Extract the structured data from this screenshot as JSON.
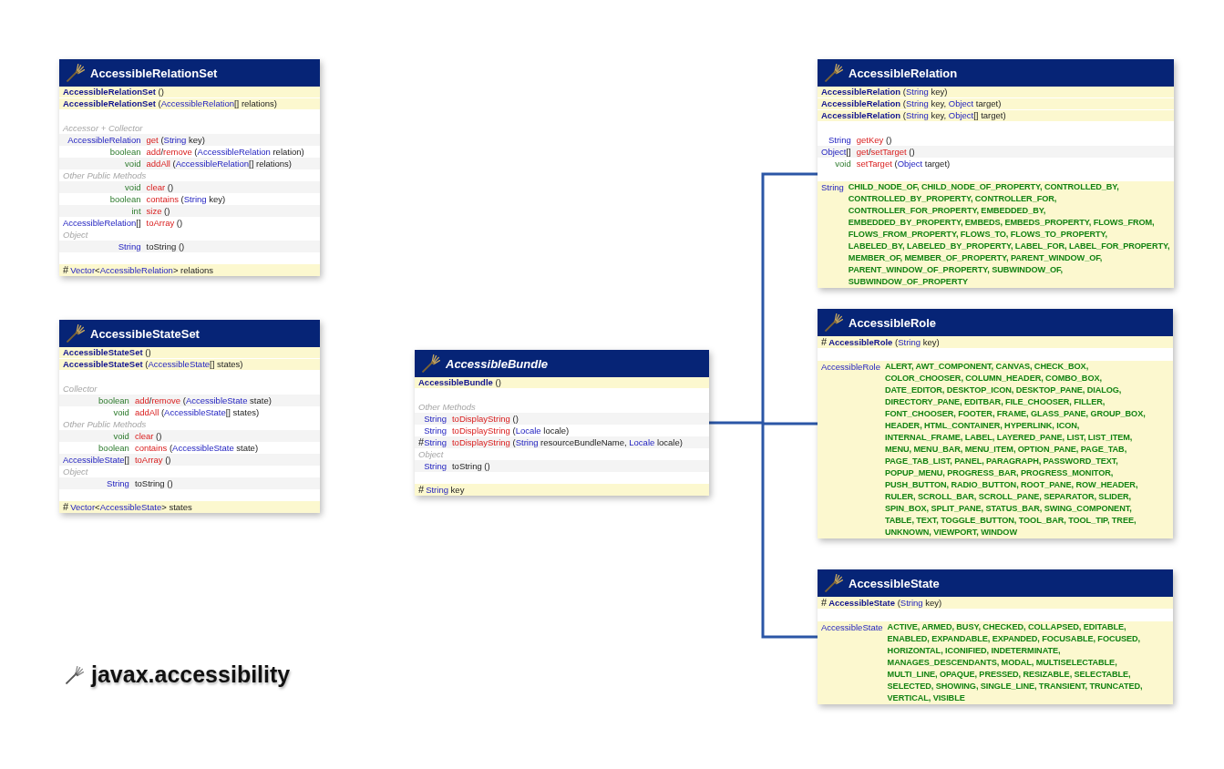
{
  "diagram": {
    "title": "javax.accessibility"
  },
  "classes": [
    {
      "name": "AccessibleRelationSet",
      "abstract": false,
      "constructors": [
        {
          "signature": [
            {
              "text": "AccessibleRelationSet",
              "kind": "ctor"
            },
            {
              "text": " ()",
              "kind": "plain"
            }
          ]
        },
        {
          "signature": [
            {
              "text": "AccessibleRelationSet",
              "kind": "ctor"
            },
            {
              "text": " (",
              "kind": "plain"
            },
            {
              "text": "AccessibleRelation",
              "kind": "class"
            },
            {
              "text": "[] relations)",
              "kind": "plain"
            }
          ]
        }
      ],
      "method_groups": [
        {
          "label": "Accessor + Collector",
          "methods": [
            {
              "type": [
                {
                  "text": "AccessibleRelation",
                  "kind": "class"
                }
              ],
              "signature": [
                {
                  "text": "get",
                  "kind": "method"
                },
                {
                  "text": " (",
                  "kind": "plain"
                },
                {
                  "text": "String",
                  "kind": "class"
                },
                {
                  "text": " key)",
                  "kind": "plain"
                }
              ]
            },
            {
              "type": [
                {
                  "text": "boolean",
                  "kind": "primitive"
                }
              ],
              "signature": [
                {
                  "text": "add",
                  "kind": "method"
                },
                {
                  "text": "/",
                  "kind": "plain"
                },
                {
                  "text": "remove",
                  "kind": "method"
                },
                {
                  "text": " (",
                  "kind": "plain"
                },
                {
                  "text": "AccessibleRelation",
                  "kind": "class"
                },
                {
                  "text": " relation)",
                  "kind": "plain"
                }
              ]
            },
            {
              "type": [
                {
                  "text": "void",
                  "kind": "primitive"
                }
              ],
              "signature": [
                {
                  "text": "addAll",
                  "kind": "method"
                },
                {
                  "text": " (",
                  "kind": "plain"
                },
                {
                  "text": "AccessibleRelation",
                  "kind": "class"
                },
                {
                  "text": "[] relations)",
                  "kind": "plain"
                }
              ]
            }
          ]
        },
        {
          "label": "Other Public Methods",
          "methods": [
            {
              "type": [
                {
                  "text": "void",
                  "kind": "primitive"
                }
              ],
              "signature": [
                {
                  "text": "clear",
                  "kind": "method"
                },
                {
                  "text": " ()",
                  "kind": "plain"
                }
              ]
            },
            {
              "type": [
                {
                  "text": "boolean",
                  "kind": "primitive"
                }
              ],
              "signature": [
                {
                  "text": "contains",
                  "kind": "method"
                },
                {
                  "text": " (",
                  "kind": "plain"
                },
                {
                  "text": "String",
                  "kind": "class"
                },
                {
                  "text": " key)",
                  "kind": "plain"
                }
              ]
            },
            {
              "type": [
                {
                  "text": "int",
                  "kind": "primitive"
                }
              ],
              "signature": [
                {
                  "text": "size",
                  "kind": "method"
                },
                {
                  "text": " ()",
                  "kind": "plain"
                }
              ]
            },
            {
              "type": [
                {
                  "text": "AccessibleRelation",
                  "kind": "class"
                },
                {
                  "text": "[]",
                  "kind": "plain"
                }
              ],
              "signature": [
                {
                  "text": "toArray",
                  "kind": "method"
                },
                {
                  "text": " ()",
                  "kind": "plain"
                }
              ]
            }
          ]
        },
        {
          "label": "Object",
          "methods": [
            {
              "type": [
                {
                  "text": "String",
                  "kind": "class"
                }
              ],
              "signature": [
                {
                  "text": "toString ()",
                  "kind": "plain"
                }
              ]
            }
          ]
        }
      ],
      "fields": [
        {
          "kind": "field",
          "modifier": "#",
          "declaration": [
            {
              "text": "Vector",
              "kind": "class"
            },
            {
              "text": "<",
              "kind": "plain"
            },
            {
              "text": "AccessibleRelation",
              "kind": "class"
            },
            {
              "text": "> relations",
              "kind": "plain"
            }
          ]
        }
      ]
    },
    {
      "name": "AccessibleStateSet",
      "abstract": false,
      "constructors": [
        {
          "signature": [
            {
              "text": "AccessibleStateSet",
              "kind": "ctor"
            },
            {
              "text": " ()",
              "kind": "plain"
            }
          ]
        },
        {
          "signature": [
            {
              "text": "AccessibleStateSet",
              "kind": "ctor"
            },
            {
              "text": " (",
              "kind": "plain"
            },
            {
              "text": "AccessibleState",
              "kind": "class"
            },
            {
              "text": "[] states)",
              "kind": "plain"
            }
          ]
        }
      ],
      "method_groups": [
        {
          "label": "Collector",
          "methods": [
            {
              "type": [
                {
                  "text": "boolean",
                  "kind": "primitive"
                }
              ],
              "signature": [
                {
                  "text": "add",
                  "kind": "method"
                },
                {
                  "text": "/",
                  "kind": "plain"
                },
                {
                  "text": "remove",
                  "kind": "method"
                },
                {
                  "text": " (",
                  "kind": "plain"
                },
                {
                  "text": "AccessibleState",
                  "kind": "class"
                },
                {
                  "text": " state)",
                  "kind": "plain"
                }
              ]
            },
            {
              "type": [
                {
                  "text": "void",
                  "kind": "primitive"
                }
              ],
              "signature": [
                {
                  "text": "addAll",
                  "kind": "method"
                },
                {
                  "text": " (",
                  "kind": "plain"
                },
                {
                  "text": "AccessibleState",
                  "kind": "class"
                },
                {
                  "text": "[] states)",
                  "kind": "plain"
                }
              ]
            }
          ]
        },
        {
          "label": "Other Public Methods",
          "methods": [
            {
              "type": [
                {
                  "text": "void",
                  "kind": "primitive"
                }
              ],
              "signature": [
                {
                  "text": "clear",
                  "kind": "method"
                },
                {
                  "text": " ()",
                  "kind": "plain"
                }
              ]
            },
            {
              "type": [
                {
                  "text": "boolean",
                  "kind": "primitive"
                }
              ],
              "signature": [
                {
                  "text": "contains",
                  "kind": "method"
                },
                {
                  "text": " (",
                  "kind": "plain"
                },
                {
                  "text": "AccessibleState",
                  "kind": "class"
                },
                {
                  "text": " state)",
                  "kind": "plain"
                }
              ]
            },
            {
              "type": [
                {
                  "text": "AccessibleState",
                  "kind": "class"
                },
                {
                  "text": "[]",
                  "kind": "plain"
                }
              ],
              "signature": [
                {
                  "text": "toArray",
                  "kind": "method"
                },
                {
                  "text": " ()",
                  "kind": "plain"
                }
              ]
            }
          ]
        },
        {
          "label": "Object",
          "methods": [
            {
              "type": [
                {
                  "text": "String",
                  "kind": "class"
                }
              ],
              "signature": [
                {
                  "text": "toString ()",
                  "kind": "plain"
                }
              ]
            }
          ]
        }
      ],
      "fields": [
        {
          "kind": "field",
          "modifier": "#",
          "declaration": [
            {
              "text": "Vector",
              "kind": "class"
            },
            {
              "text": "<",
              "kind": "plain"
            },
            {
              "text": "AccessibleState",
              "kind": "class"
            },
            {
              "text": "> states",
              "kind": "plain"
            }
          ]
        }
      ]
    },
    {
      "name": "AccessibleBundle",
      "abstract": true,
      "constructors": [
        {
          "signature": [
            {
              "text": "AccessibleBundle",
              "kind": "ctor"
            },
            {
              "text": " ()",
              "kind": "plain"
            }
          ]
        }
      ],
      "method_groups": [
        {
          "label": "Other Methods",
          "methods": [
            {
              "type": [
                {
                  "text": "String",
                  "kind": "class"
                }
              ],
              "signature": [
                {
                  "text": "toDisplayString",
                  "kind": "method"
                },
                {
                  "text": " ()",
                  "kind": "plain"
                }
              ]
            },
            {
              "type": [
                {
                  "text": "String",
                  "kind": "class"
                }
              ],
              "signature": [
                {
                  "text": "toDisplayString",
                  "kind": "method"
                },
                {
                  "text": " (",
                  "kind": "plain"
                },
                {
                  "text": "Locale",
                  "kind": "class"
                },
                {
                  "text": " locale)",
                  "kind": "plain"
                }
              ]
            },
            {
              "modifier": "#",
              "type": [
                {
                  "text": "String",
                  "kind": "class"
                }
              ],
              "signature": [
                {
                  "text": "toDisplayString",
                  "kind": "method"
                },
                {
                  "text": " (",
                  "kind": "plain"
                },
                {
                  "text": "String",
                  "kind": "class"
                },
                {
                  "text": " resourceBundleName, ",
                  "kind": "plain"
                },
                {
                  "text": "Locale",
                  "kind": "class"
                },
                {
                  "text": " locale)",
                  "kind": "plain"
                }
              ]
            }
          ]
        },
        {
          "label": "Object",
          "methods": [
            {
              "type": [
                {
                  "text": "String",
                  "kind": "class"
                }
              ],
              "signature": [
                {
                  "text": "toString ()",
                  "kind": "plain"
                }
              ]
            }
          ]
        }
      ],
      "fields": [
        {
          "kind": "field",
          "modifier": "#",
          "declaration": [
            {
              "text": "String",
              "kind": "class"
            },
            {
              "text": " key",
              "kind": "plain"
            }
          ]
        }
      ]
    },
    {
      "name": "AccessibleRelation",
      "abstract": false,
      "constructors": [
        {
          "signature": [
            {
              "text": "AccessibleRelation",
              "kind": "ctor"
            },
            {
              "text": " (",
              "kind": "plain"
            },
            {
              "text": "String",
              "kind": "class"
            },
            {
              "text": " key)",
              "kind": "plain"
            }
          ]
        },
        {
          "signature": [
            {
              "text": "AccessibleRelation",
              "kind": "ctor"
            },
            {
              "text": " (",
              "kind": "plain"
            },
            {
              "text": "String",
              "kind": "class"
            },
            {
              "text": " key, ",
              "kind": "plain"
            },
            {
              "text": "Object",
              "kind": "class"
            },
            {
              "text": " target)",
              "kind": "plain"
            }
          ]
        },
        {
          "signature": [
            {
              "text": "AccessibleRelation",
              "kind": "ctor"
            },
            {
              "text": " (",
              "kind": "plain"
            },
            {
              "text": "String",
              "kind": "class"
            },
            {
              "text": " key, ",
              "kind": "plain"
            },
            {
              "text": "Object",
              "kind": "class"
            },
            {
              "text": "[] target)",
              "kind": "plain"
            }
          ]
        }
      ],
      "method_groups": [
        {
          "methods": [
            {
              "type": [
                {
                  "text": "String",
                  "kind": "class"
                }
              ],
              "signature": [
                {
                  "text": "getKey",
                  "kind": "method"
                },
                {
                  "text": " ()",
                  "kind": "plain"
                }
              ]
            },
            {
              "type": [
                {
                  "text": "Object",
                  "kind": "class"
                },
                {
                  "text": "[]",
                  "kind": "plain"
                }
              ],
              "signature": [
                {
                  "text": "get",
                  "kind": "method"
                },
                {
                  "text": "/",
                  "kind": "plain"
                },
                {
                  "text": "setTarget",
                  "kind": "method"
                },
                {
                  "text": " ()",
                  "kind": "plain"
                }
              ]
            },
            {
              "type": [
                {
                  "text": "void",
                  "kind": "primitive"
                }
              ],
              "signature": [
                {
                  "text": "setTarget",
                  "kind": "method"
                },
                {
                  "text": " (",
                  "kind": "plain"
                },
                {
                  "text": "Object",
                  "kind": "class"
                },
                {
                  "text": " target)",
                  "kind": "plain"
                }
              ]
            }
          ]
        }
      ],
      "fields": [
        {
          "kind": "constants",
          "type": [
            {
              "text": "String",
              "kind": "class"
            }
          ],
          "lines": [
            "CHILD_NODE_OF, CHILD_NODE_OF_PROPERTY, CONTROLLED_BY,",
            "CONTROLLED_BY_PROPERTY, CONTROLLER_FOR,",
            "CONTROLLER_FOR_PROPERTY, EMBEDDED_BY,",
            "EMBEDDED_BY_PROPERTY, EMBEDS, EMBEDS_PROPERTY, FLOWS_FROM,",
            "FLOWS_FROM_PROPERTY, FLOWS_TO, FLOWS_TO_PROPERTY,",
            "LABELED_BY, LABELED_BY_PROPERTY, LABEL_FOR, LABEL_FOR_PROPERTY,",
            "MEMBER_OF, MEMBER_OF_PROPERTY, PARENT_WINDOW_OF,",
            "PARENT_WINDOW_OF_PROPERTY, SUBWINDOW_OF,",
            "SUBWINDOW_OF_PROPERTY"
          ]
        }
      ]
    },
    {
      "name": "AccessibleRole",
      "abstract": false,
      "constructors": [
        {
          "modifier": "#",
          "signature": [
            {
              "text": "AccessibleRole",
              "kind": "ctor"
            },
            {
              "text": " (",
              "kind": "plain"
            },
            {
              "text": "String",
              "kind": "class"
            },
            {
              "text": " key)",
              "kind": "plain"
            }
          ]
        }
      ],
      "fields": [
        {
          "kind": "constants",
          "type": [
            {
              "text": "AccessibleRole",
              "kind": "class"
            }
          ],
          "lines": [
            "ALERT, AWT_COMPONENT, CANVAS, CHECK_BOX,",
            "COLOR_CHOOSER, COLUMN_HEADER, COMBO_BOX,",
            "DATE_EDITOR, DESKTOP_ICON, DESKTOP_PANE, DIALOG,",
            "DIRECTORY_PANE, EDITBAR, FILE_CHOOSER, FILLER,",
            "FONT_CHOOSER, FOOTER, FRAME, GLASS_PANE, GROUP_BOX,",
            "HEADER, HTML_CONTAINER, HYPERLINK, ICON,",
            "INTERNAL_FRAME, LABEL, LAYERED_PANE, LIST, LIST_ITEM,",
            "MENU, MENU_BAR, MENU_ITEM, OPTION_PANE, PAGE_TAB,",
            "PAGE_TAB_LIST, PANEL, PARAGRAPH, PASSWORD_TEXT,",
            "POPUP_MENU, PROGRESS_BAR, PROGRESS_MONITOR,",
            "PUSH_BUTTON, RADIO_BUTTON, ROOT_PANE, ROW_HEADER,",
            "RULER, SCROLL_BAR, SCROLL_PANE, SEPARATOR, SLIDER,",
            "SPIN_BOX, SPLIT_PANE, STATUS_BAR, SWING_COMPONENT,",
            "TABLE, TEXT, TOGGLE_BUTTON, TOOL_BAR, TOOL_TIP, TREE,",
            "UNKNOWN, VIEWPORT, WINDOW"
          ]
        }
      ]
    },
    {
      "name": "AccessibleState",
      "abstract": false,
      "constructors": [
        {
          "modifier": "#",
          "signature": [
            {
              "text": "AccessibleState",
              "kind": "ctor"
            },
            {
              "text": " (",
              "kind": "plain"
            },
            {
              "text": "String",
              "kind": "class"
            },
            {
              "text": " key)",
              "kind": "plain"
            }
          ]
        }
      ],
      "fields": [
        {
          "kind": "constants",
          "type": [
            {
              "text": "AccessibleState",
              "kind": "class"
            }
          ],
          "lines": [
            "ACTIVE, ARMED, BUSY, CHECKED, COLLAPSED, EDITABLE,",
            "ENABLED, EXPANDABLE, EXPANDED, FOCUSABLE, FOCUSED,",
            "HORIZONTAL, ICONIFIED, INDETERMINATE,",
            "MANAGES_DESCENDANTS, MODAL, MULTISELECTABLE,",
            "MULTI_LINE, OPAQUE, PRESSED, RESIZABLE, SELECTABLE,",
            "SELECTED, SHOWING, SINGLE_LINE, TRANSIENT, TRUNCATED,",
            "VERTICAL, VISIBLE"
          ]
        }
      ]
    }
  ]
}
